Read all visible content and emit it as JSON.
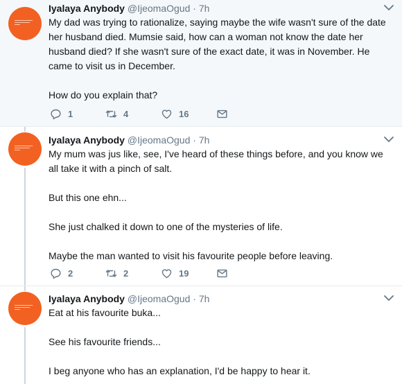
{
  "tweets": [
    {
      "name": "Iyalaya Anybody",
      "handle": "@IjeomaOgud",
      "separator": "·",
      "time": "7h",
      "paragraphs": [
        "My dad was trying to rationalize, saying maybe the wife wasn't sure of the date her husband died. Mumsie said, how can a woman not know the date her husband died? If she wasn't sure of the exact date, it was in November. He came to visit us in December.",
        "How do you explain that?"
      ],
      "replies": "1",
      "retweets": "4",
      "likes": "16"
    },
    {
      "name": "Iyalaya Anybody",
      "handle": "@IjeomaOgud",
      "separator": "·",
      "time": "7h",
      "paragraphs": [
        "My mum was jus like, see, I've heard of these things before, and you know we all take it with a pinch of salt.",
        "But this one ehn...",
        "She just chalked it down to one of the mysteries of life.",
        "Maybe the man wanted to visit his favourite people before leaving."
      ],
      "replies": "2",
      "retweets": "2",
      "likes": "19"
    },
    {
      "name": "Iyalaya Anybody",
      "handle": "@IjeomaOgud",
      "separator": "·",
      "time": "7h",
      "paragraphs": [
        "Eat at his favourite buka...",
        "See his favourite friends...",
        "I beg anyone who has an explanation, I'd be happy to hear it."
      ]
    }
  ],
  "colors": {
    "avatar": "#f26122",
    "thread_line": "#ccd6dd",
    "secondary_text": "#657786",
    "highlight_bg": "#f5f8fa"
  },
  "icons": [
    "reply-icon",
    "retweet-icon",
    "like-icon",
    "direct-message-icon",
    "chevron-down-icon"
  ]
}
